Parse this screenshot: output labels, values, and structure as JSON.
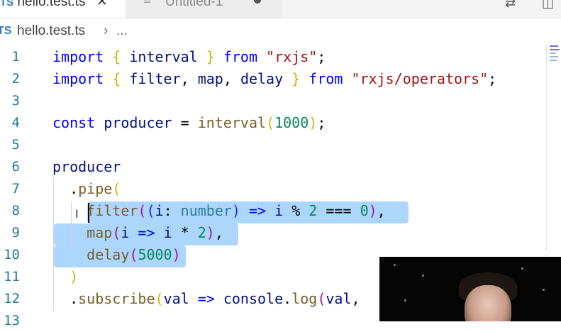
{
  "tabs": [
    {
      "label": "hello.test.ts",
      "badge": "TS",
      "close_glyph": "✕",
      "active": true
    },
    {
      "label": "Untitled-1",
      "active": false,
      "icon": "menu-icon"
    }
  ],
  "toolbar": {
    "icons": [
      "source-control-compare-icon",
      "split-editor-icon"
    ]
  },
  "breadcrumb": {
    "badge": "TS",
    "file": "hello.test.ts",
    "separator": "›",
    "more": "..."
  },
  "editor": {
    "colors": {
      "keyword": "#0000ff",
      "plain": "#001080",
      "function": "#795e26",
      "string": "#a31515",
      "number": "#098658",
      "bracket_gold": "#d4b200",
      "bracket_purple": "#a315a3",
      "bracket_blue": "#0431fa",
      "type": "#267f99",
      "line_number": "#237893",
      "selection": "#add6ff"
    },
    "lines": [
      {
        "n": "1",
        "tokens": [
          {
            "t": "import",
            "c": "keyword"
          },
          {
            "t": " { ",
            "c": "bracket_gold"
          },
          {
            "t": "interval",
            "c": "plain"
          },
          {
            "t": " } ",
            "c": "bracket_gold"
          },
          {
            "t": "from",
            "c": "keyword"
          },
          {
            "t": " ",
            "c": "plain"
          },
          {
            "t": "\"rxjs\"",
            "c": "string"
          },
          {
            "t": ";",
            "c": "default"
          }
        ]
      },
      {
        "n": "2",
        "tokens": [
          {
            "t": "import",
            "c": "keyword"
          },
          {
            "t": " { ",
            "c": "bracket_gold"
          },
          {
            "t": "filter",
            "c": "plain"
          },
          {
            "t": ", ",
            "c": "default"
          },
          {
            "t": "map",
            "c": "plain"
          },
          {
            "t": ", ",
            "c": "default"
          },
          {
            "t": "delay",
            "c": "plain"
          },
          {
            "t": " } ",
            "c": "bracket_gold"
          },
          {
            "t": "from",
            "c": "keyword"
          },
          {
            "t": " ",
            "c": "plain"
          },
          {
            "t": "\"rxjs/operators\"",
            "c": "string"
          },
          {
            "t": ";",
            "c": "default"
          }
        ]
      },
      {
        "n": "3",
        "tokens": []
      },
      {
        "n": "4",
        "tokens": [
          {
            "t": "const",
            "c": "keyword"
          },
          {
            "t": " ",
            "c": "plain"
          },
          {
            "t": "producer",
            "c": "plain"
          },
          {
            "t": " = ",
            "c": "default"
          },
          {
            "t": "interval",
            "c": "function"
          },
          {
            "t": "(",
            "c": "bracket_gold"
          },
          {
            "t": "1000",
            "c": "number"
          },
          {
            "t": ")",
            "c": "bracket_gold"
          },
          {
            "t": ";",
            "c": "default"
          }
        ]
      },
      {
        "n": "5",
        "tokens": []
      },
      {
        "n": "6",
        "tokens": [
          {
            "t": "producer",
            "c": "plain"
          }
        ]
      },
      {
        "n": "7",
        "tokens": [
          {
            "t": "  .",
            "c": "default"
          },
          {
            "t": "pipe",
            "c": "function"
          },
          {
            "t": "(",
            "c": "bracket_gold"
          }
        ]
      },
      {
        "n": "8",
        "tokens": [
          {
            "t": "    ",
            "c": "default"
          },
          {
            "t": "filter",
            "c": "function"
          },
          {
            "t": "(",
            "c": "bracket_purple"
          },
          {
            "t": "(",
            "c": "bracket_blue"
          },
          {
            "t": "i",
            "c": "plain"
          },
          {
            "t": ": ",
            "c": "default"
          },
          {
            "t": "number",
            "c": "type"
          },
          {
            "t": ")",
            "c": "bracket_blue"
          },
          {
            "t": " => ",
            "c": "keyword"
          },
          {
            "t": "i",
            "c": "plain"
          },
          {
            "t": " % ",
            "c": "default"
          },
          {
            "t": "2",
            "c": "number"
          },
          {
            "t": " === ",
            "c": "default"
          },
          {
            "t": "0",
            "c": "number"
          },
          {
            "t": ")",
            "c": "bracket_purple"
          },
          {
            "t": ",",
            "c": "default"
          }
        ]
      },
      {
        "n": "9",
        "tokens": [
          {
            "t": "    ",
            "c": "default"
          },
          {
            "t": "map",
            "c": "function"
          },
          {
            "t": "(",
            "c": "bracket_purple"
          },
          {
            "t": "i",
            "c": "plain"
          },
          {
            "t": " => ",
            "c": "keyword"
          },
          {
            "t": "i",
            "c": "plain"
          },
          {
            "t": " * ",
            "c": "default"
          },
          {
            "t": "2",
            "c": "number"
          },
          {
            "t": ")",
            "c": "bracket_purple"
          },
          {
            "t": ",",
            "c": "default"
          }
        ]
      },
      {
        "n": "10",
        "tokens": [
          {
            "t": "    ",
            "c": "default"
          },
          {
            "t": "delay",
            "c": "function"
          },
          {
            "t": "(",
            "c": "bracket_purple"
          },
          {
            "t": "5000",
            "c": "number"
          },
          {
            "t": ")",
            "c": "bracket_purple"
          }
        ]
      },
      {
        "n": "11",
        "tokens": [
          {
            "t": "  ",
            "c": "default"
          },
          {
            "t": ")",
            "c": "bracket_gold"
          }
        ]
      },
      {
        "n": "12",
        "tokens": [
          {
            "t": "  .",
            "c": "default"
          },
          {
            "t": "subscribe",
            "c": "function"
          },
          {
            "t": "(",
            "c": "bracket_gold"
          },
          {
            "t": "val",
            "c": "plain"
          },
          {
            "t": " => ",
            "c": "keyword"
          },
          {
            "t": "console",
            "c": "plain"
          },
          {
            "t": ".",
            "c": "default"
          },
          {
            "t": "log",
            "c": "function"
          },
          {
            "t": "(",
            "c": "bracket_purple"
          },
          {
            "t": "val",
            "c": "plain"
          },
          {
            "t": ",",
            "c": "default"
          }
        ]
      },
      {
        "n": "13",
        "tokens": []
      }
    ]
  }
}
